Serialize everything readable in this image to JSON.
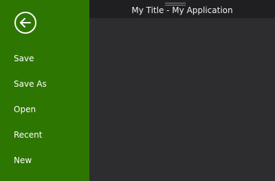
{
  "window": {
    "title": "My Title - My Application"
  },
  "sidebar": {
    "back_icon": "back-arrow-circle-icon",
    "items": [
      {
        "label": "Save"
      },
      {
        "label": "Save As"
      },
      {
        "label": "Open"
      },
      {
        "label": "Recent"
      },
      {
        "label": "New"
      }
    ]
  },
  "colors": {
    "sidebar_background": "#2e7602",
    "titlebar_background": "#1f1f22",
    "content_background": "#2d2d30",
    "text_primary": "#ffffff"
  }
}
